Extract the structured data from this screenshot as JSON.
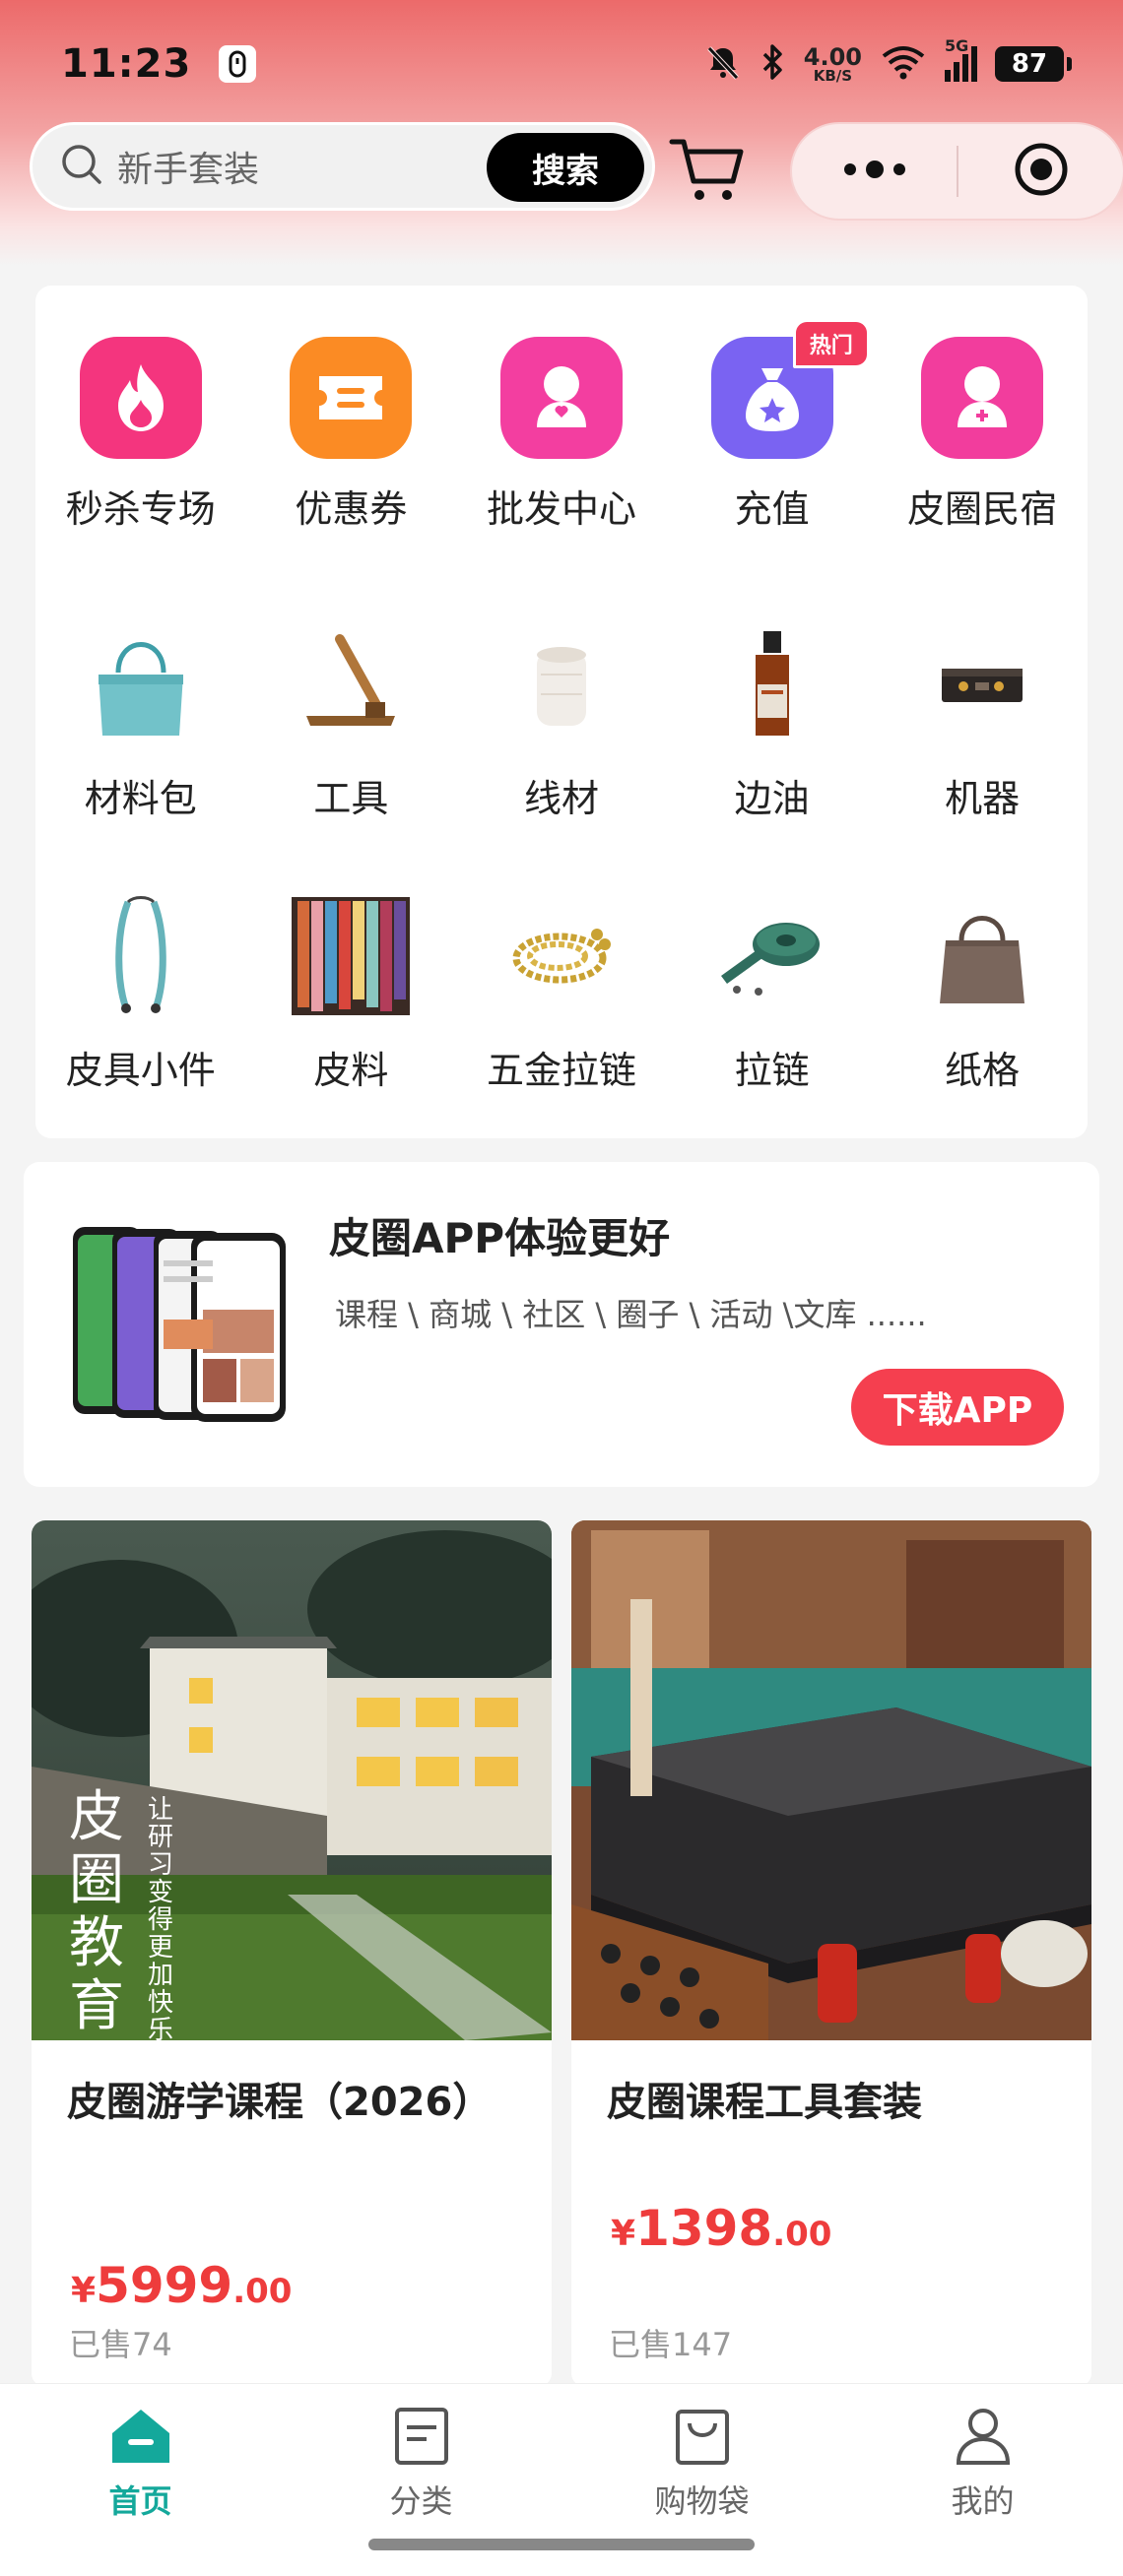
{
  "status_bar": {
    "time": "11:23",
    "net_speed_value": "4.00",
    "net_speed_unit": "KB/S",
    "network_type": "5G",
    "battery": "87"
  },
  "search": {
    "placeholder": "新手套装",
    "button_label": "搜索"
  },
  "quick_entries": [
    {
      "label": "秒杀专场",
      "icon": "flame-icon",
      "color": "#f4357e"
    },
    {
      "label": "优惠券",
      "icon": "coupon-icon",
      "color": "#fb8b24"
    },
    {
      "label": "批发中心",
      "icon": "wholesale-icon",
      "color": "#f33ea0"
    },
    {
      "label": "充值",
      "icon": "money-bag-icon",
      "color": "#7a63f2",
      "badge": "热门"
    },
    {
      "label": "皮圈民宿",
      "icon": "homestay-icon",
      "color": "#f23d9d"
    }
  ],
  "categories": [
    {
      "label": "材料包",
      "icon": "handbag-thumb"
    },
    {
      "label": "工具",
      "icon": "tool-stand-thumb"
    },
    {
      "label": "线材",
      "icon": "thread-spool-thumb"
    },
    {
      "label": "边油",
      "icon": "edge-oil-bottle-thumb"
    },
    {
      "label": "机器",
      "icon": "machine-thumb"
    },
    {
      "label": "皮具小件",
      "icon": "strap-thumb"
    },
    {
      "label": "皮料",
      "icon": "leather-hides-thumb"
    },
    {
      "label": "五金拉链",
      "icon": "chain-thumb"
    },
    {
      "label": "拉链",
      "icon": "zipper-roll-thumb"
    },
    {
      "label": "纸格",
      "icon": "tote-bag-thumb"
    }
  ],
  "app_promo": {
    "title": "皮圈APP体验更好",
    "subtitle": "课程 \\ 商城 \\ 社区 \\ 圈子 \\ 活动 \\文库 ......",
    "button_label": "下载APP"
  },
  "products": [
    {
      "name": "皮圈游学课程（2026）",
      "image_text_1": "皮圈教育",
      "image_text_2": "让研习变得更加快乐",
      "price_symbol": "¥",
      "price_int": "5999",
      "price_dec": ".00",
      "sold": "已售74"
    },
    {
      "name": "皮圈课程工具套装",
      "price_symbol": "¥",
      "price_int": "1398",
      "price_dec": ".00",
      "sold": "已售147"
    }
  ],
  "tabbar": [
    {
      "label": "首页",
      "icon": "home-icon",
      "active": true
    },
    {
      "label": "分类",
      "icon": "category-icon",
      "active": false
    },
    {
      "label": "购物袋",
      "icon": "shopping-bag-icon",
      "active": false
    },
    {
      "label": "我的",
      "icon": "profile-icon",
      "active": false
    }
  ],
  "colors": {
    "accent": "#14a89b",
    "price": "#ee3c3c",
    "download_button": "#f53f4f"
  }
}
